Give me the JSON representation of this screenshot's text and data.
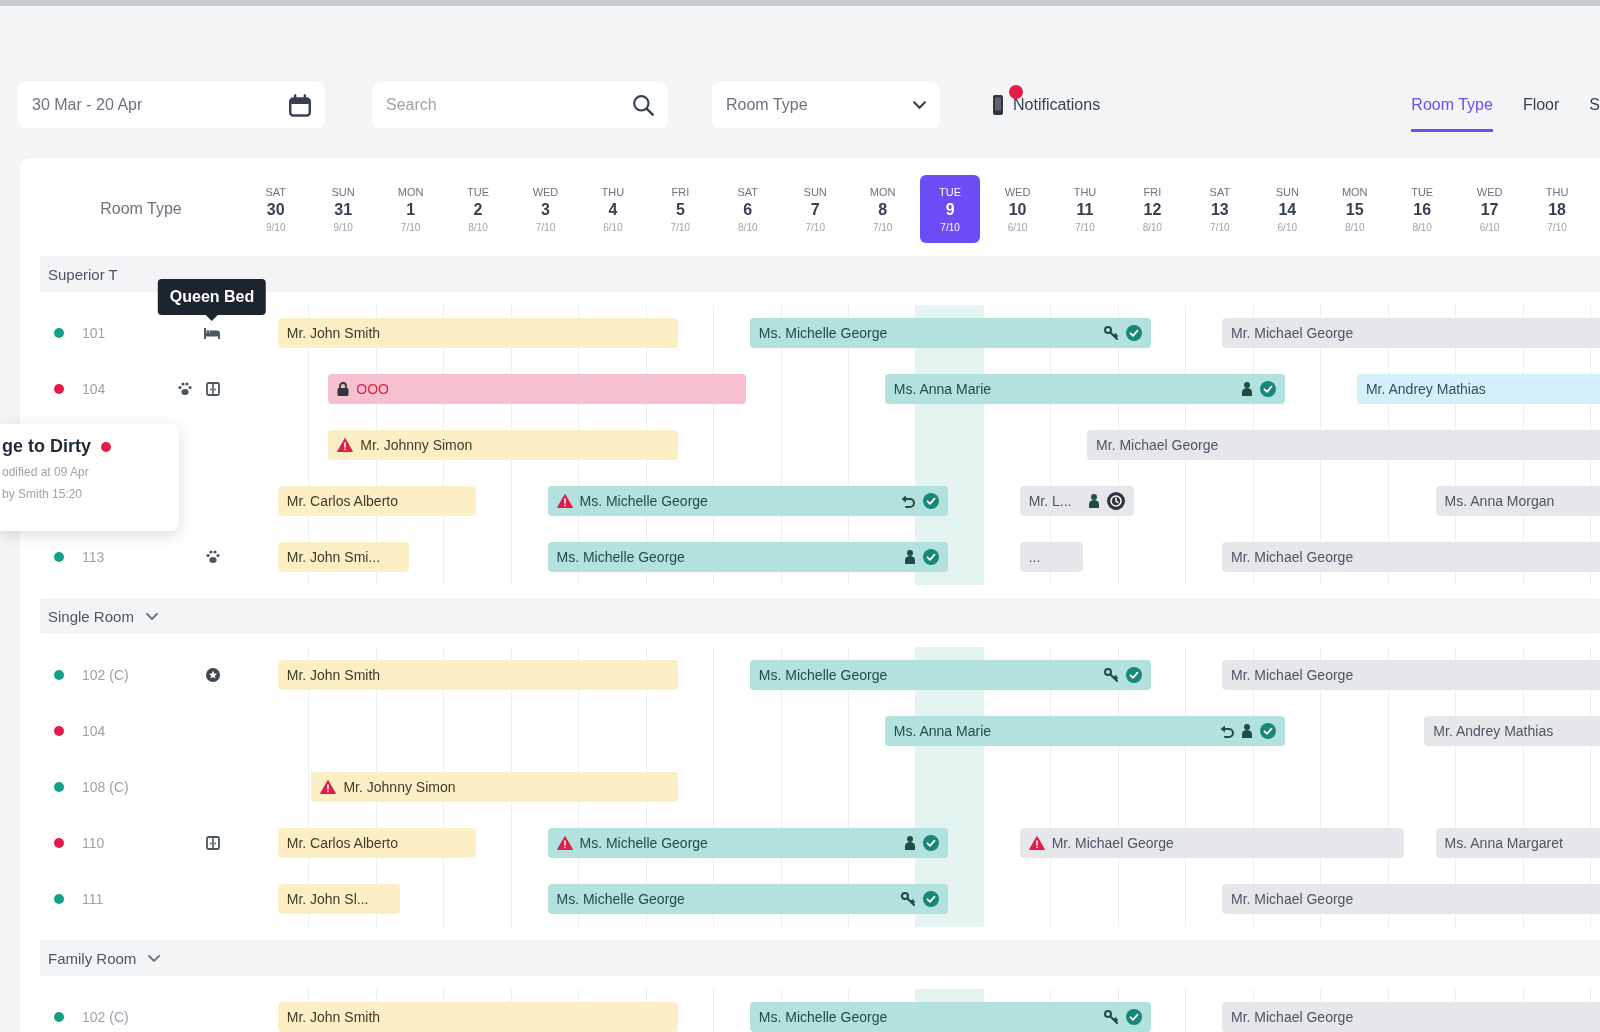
{
  "toolbar": {
    "date_range": "30 Mar - 20 Apr",
    "search": {
      "placeholder": "Search"
    },
    "room_type": {
      "value": "Room Type"
    },
    "notifications": {
      "label": "Notifications",
      "unread": true
    }
  },
  "view_tabs": [
    {
      "label": "Room Type",
      "selected": true
    },
    {
      "label": "Floor",
      "selected": false
    },
    {
      "label": "S",
      "selected": false
    }
  ],
  "calendar": {
    "corner_label": "Room Type",
    "days": [
      {
        "weekday": "SAT",
        "day": "30",
        "occupancy": "9/10",
        "selected": false
      },
      {
        "weekday": "SUN",
        "day": "31",
        "occupancy": "9/10",
        "selected": false
      },
      {
        "weekday": "MON",
        "day": "1",
        "occupancy": "7/10",
        "selected": false
      },
      {
        "weekday": "TUE",
        "day": "2",
        "occupancy": "8/10",
        "selected": false
      },
      {
        "weekday": "WED",
        "day": "3",
        "occupancy": "7/10",
        "selected": false
      },
      {
        "weekday": "THU",
        "day": "4",
        "occupancy": "6/10",
        "selected": false
      },
      {
        "weekday": "FRI",
        "day": "5",
        "occupancy": "7/10",
        "selected": false
      },
      {
        "weekday": "SAT",
        "day": "6",
        "occupancy": "8/10",
        "selected": false
      },
      {
        "weekday": "SUN",
        "day": "7",
        "occupancy": "7/10",
        "selected": false
      },
      {
        "weekday": "MON",
        "day": "8",
        "occupancy": "7/10",
        "selected": false
      },
      {
        "weekday": "TUE",
        "day": "9",
        "occupancy": "7/10",
        "selected": true
      },
      {
        "weekday": "WED",
        "day": "10",
        "occupancy": "6/10",
        "selected": false
      },
      {
        "weekday": "THU",
        "day": "11",
        "occupancy": "7/10",
        "selected": false
      },
      {
        "weekday": "FRI",
        "day": "12",
        "occupancy": "8/10",
        "selected": false
      },
      {
        "weekday": "SAT",
        "day": "13",
        "occupancy": "7/10",
        "selected": false
      },
      {
        "weekday": "SUN",
        "day": "14",
        "occupancy": "6/10",
        "selected": false
      },
      {
        "weekday": "MON",
        "day": "15",
        "occupancy": "8/10",
        "selected": false
      },
      {
        "weekday": "TUE",
        "day": "16",
        "occupancy": "8/10",
        "selected": false
      },
      {
        "weekday": "WED",
        "day": "17",
        "occupancy": "6/10",
        "selected": false
      },
      {
        "weekday": "THU",
        "day": "18",
        "occupancy": "7/10",
        "selected": false
      }
    ],
    "groups": [
      {
        "name": "Superior T",
        "rooms": [
          {
            "name": "101",
            "color": "#12a182",
            "amenities": [
              {
                "kind": "bed",
                "tooltip": "Queen Bed"
              }
            ],
            "bookings": [
              {
                "label": "Mr. John Smith",
                "kind": "departed",
                "alert": false
              },
              {
                "label": "Ms. Michelle George",
                "kind": "inhouse",
                "alert": false,
                "indicators": [
                  {
                    "kind": "key"
                  },
                  {
                    "kind": "paid"
                  }
                ]
              },
              {
                "label": "Mr. Michael George",
                "kind": "reserved",
                "alert": false
              }
            ]
          },
          {
            "name": "104",
            "color": "#e11d48",
            "amenities": [
              {
                "kind": "pet"
              },
              {
                "kind": "connecting"
              }
            ],
            "bookings": [
              {
                "label": "OOO",
                "kind": "blocked",
                "alert": false
              },
              {
                "label": "Ms. Anna Marie",
                "kind": "inhouse",
                "alert": false,
                "indicators": [
                  {
                    "kind": "guest"
                  },
                  {
                    "kind": "paid"
                  }
                ]
              },
              {
                "label": "Mr. Andrey Mathias",
                "kind": "confirmed",
                "alert": false
              }
            ]
          },
          {
            "bookings": [
              {
                "label": "Mr. Johnny Simon",
                "kind": "departed",
                "alert": true
              },
              {
                "label": "Mr. Michael George",
                "kind": "reserved",
                "alert": false
              }
            ]
          },
          {
            "bookings": [
              {
                "label": "Mr. Carlos Alberto",
                "kind": "departed",
                "alert": false
              },
              {
                "label": "Ms. Michelle George",
                "kind": "inhouse",
                "alert": true,
                "indicators": [
                  {
                    "kind": "undo"
                  },
                  {
                    "kind": "paid"
                  }
                ]
              },
              {
                "label": "Mr. L...",
                "kind": "reserved",
                "alert": false,
                "indicators": [
                  {
                    "kind": "guest"
                  },
                  {
                    "kind": "hold"
                  }
                ]
              },
              {
                "label": "Ms. Anna Morgan",
                "kind": "reserved",
                "alert": false
              }
            ]
          },
          {
            "name": "113",
            "color": "#12a182",
            "amenities": [
              {
                "kind": "pet"
              }
            ],
            "bookings": [
              {
                "label": "Mr. John Smi...",
                "kind": "departed",
                "alert": false
              },
              {
                "label": "Ms. Michelle George",
                "kind": "inhouse",
                "alert": false,
                "indicators": [
                  {
                    "kind": "guest"
                  },
                  {
                    "kind": "paid"
                  }
                ]
              },
              {
                "label": "...",
                "kind": "reserved",
                "alert": false
              },
              {
                "label": "Mr. Michael George",
                "kind": "reserved",
                "alert": false
              }
            ]
          }
        ]
      },
      {
        "name": "Single Room",
        "expanded": true,
        "rooms": [
          {
            "name": "102 (C)",
            "color": "#12a182",
            "amenities": [
              {
                "kind": "vip"
              }
            ],
            "bookings": [
              {
                "label": "Mr. John Smith",
                "kind": "departed",
                "alert": false
              },
              {
                "label": "Ms. Michelle George",
                "kind": "inhouse",
                "alert": false,
                "indicators": [
                  {
                    "kind": "key"
                  },
                  {
                    "kind": "paid"
                  }
                ]
              },
              {
                "label": "Mr. Michael George",
                "kind": "reserved",
                "alert": false
              }
            ]
          },
          {
            "name": "104",
            "color": "#e11d48",
            "bookings": [
              {
                "label": "Ms. Anna Marie",
                "kind": "inhouse",
                "alert": false,
                "indicators": [
                  {
                    "kind": "undo"
                  },
                  {
                    "kind": "guest"
                  },
                  {
                    "kind": "paid"
                  }
                ]
              },
              {
                "label": "Mr. Andrey Mathias",
                "kind": "reserved",
                "alert": false
              }
            ]
          },
          {
            "name": "108 (C)",
            "color": "#12a182",
            "bookings": [
              {
                "label": "Mr. Johnny Simon",
                "kind": "departed",
                "alert": true
              }
            ]
          },
          {
            "name": "110",
            "color": "#e11d48",
            "amenities": [
              {
                "kind": "connecting"
              }
            ],
            "bookings": [
              {
                "label": "Mr. Carlos Alberto",
                "kind": "departed",
                "alert": false
              },
              {
                "label": "Ms. Michelle George",
                "kind": "inhouse",
                "alert": true,
                "indicators": [
                  {
                    "kind": "guest"
                  },
                  {
                    "kind": "paid"
                  }
                ]
              },
              {
                "label": "Mr. Michael George",
                "kind": "reserved",
                "alert": true
              },
              {
                "label": "Ms. Anna Margaret",
                "kind": "reserved",
                "alert": false
              }
            ]
          },
          {
            "name": "111",
            "color": "#12a182",
            "bookings": [
              {
                "label": "Mr. John Sl...",
                "kind": "departed",
                "alert": false
              },
              {
                "label": "Ms. Michelle George",
                "kind": "inhouse",
                "alert": false,
                "indicators": [
                  {
                    "kind": "key"
                  },
                  {
                    "kind": "paid"
                  }
                ]
              },
              {
                "label": "Mr. Michael George",
                "kind": "reserved",
                "alert": false
              }
            ]
          }
        ]
      },
      {
        "name": "Family Room",
        "expanded": true,
        "rooms": [
          {
            "name": "102 (C)",
            "color": "#12a182",
            "bookings": [
              {
                "label": "Mr. John Smith",
                "kind": "departed",
                "alert": false
              },
              {
                "label": "Ms. Michelle George",
                "kind": "inhouse",
                "alert": false,
                "indicators": [
                  {
                    "kind": "key"
                  },
                  {
                    "kind": "paid"
                  }
                ]
              },
              {
                "label": "Mr. Michael George",
                "kind": "reserved",
                "alert": false
              }
            ]
          }
        ]
      }
    ]
  },
  "status_popup": {
    "title": "ge to Dirty",
    "color": "#e11d48",
    "lines": [
      "odified at 09 Apr",
      "by Smith 15:20"
    ]
  }
}
